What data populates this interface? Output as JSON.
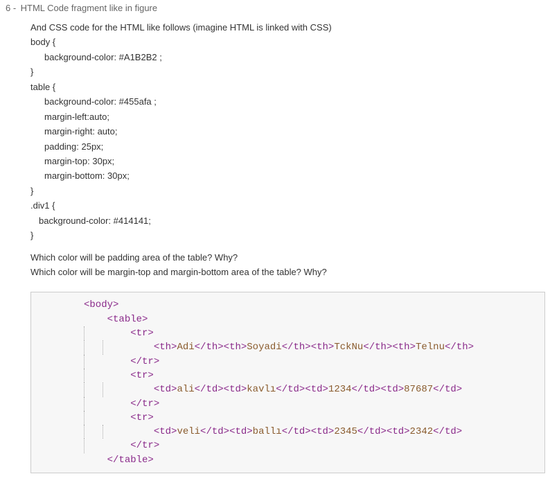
{
  "item": {
    "number": "6 -",
    "title": "HTML Code fragment like in figure"
  },
  "intro": "And CSS code for the HTML like follows (imagine HTML is linked with CSS)",
  "css": {
    "line1": "body {",
    "line2": "background-color: #A1B2B2 ;",
    "line3": "}",
    "line4": "table {",
    "line5": "background-color: #455afa ;",
    "line6": "margin-left:auto;",
    "line7": "margin-right: auto;",
    "line8": "padding: 25px;",
    "line9": "margin-top: 30px;",
    "line10": "margin-bottom: 30px;",
    "line11": "}",
    "line12": ".div1 {",
    "line13": "background-color: #414141;",
    "line14": "}"
  },
  "q1": "Which color will be padding area of the table? Why?",
  "q2": "Which color will be margin-top and margin-bottom area of the table? Why?",
  "code": {
    "t": {
      "body_o": "<body>",
      "table_o": "<table>",
      "tr_o": "<tr>",
      "tr_c": "</tr>",
      "table_c": "</table>",
      "th_o": "<th>",
      "th_c": "</th>",
      "td_o": "<td>",
      "td_c": "</td>"
    },
    "row1": {
      "c1": "Adi",
      "c2": "Soyadi",
      "c3": "TckNu",
      "c4": "Telnu"
    },
    "row2": {
      "c1": "ali",
      "c2": "kavlı",
      "c3": "1234",
      "c4": "87687"
    },
    "row3": {
      "c1": "veli",
      "c2": "ballı",
      "c3": "2345",
      "c4": "2342"
    }
  }
}
